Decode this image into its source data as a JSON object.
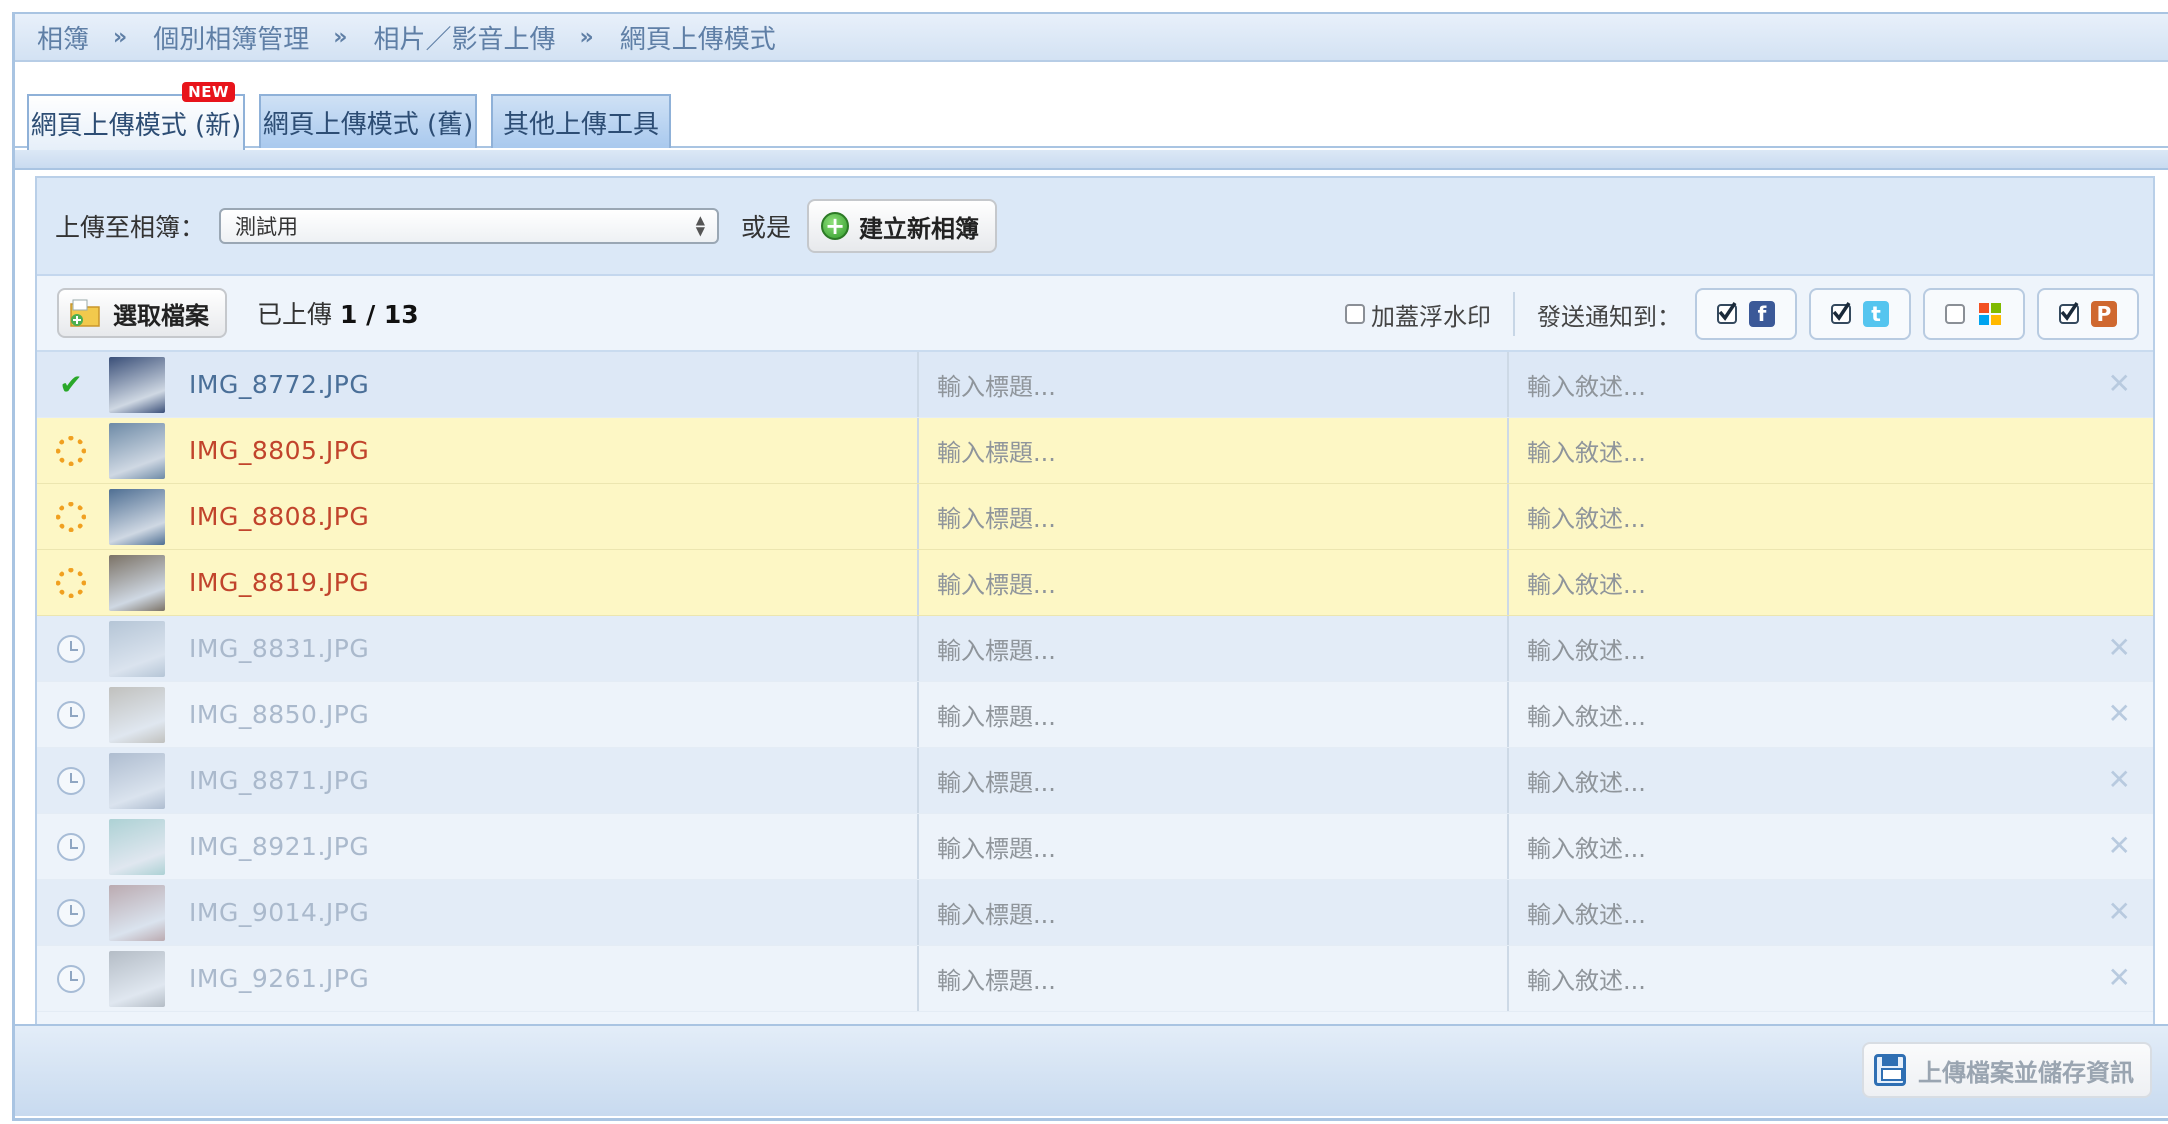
{
  "breadcrumb": {
    "items": [
      "相簿",
      "個別相簿管理",
      "相片／影音上傳",
      "網頁上傳模式"
    ],
    "separator": "»"
  },
  "tabs": [
    {
      "label": "網頁上傳模式 (新)",
      "badge": "NEW",
      "active": true
    },
    {
      "label": "網頁上傳模式 (舊)",
      "active": false
    },
    {
      "label": "其他上傳工具",
      "active": false
    }
  ],
  "album_row": {
    "label": "上傳至相簿：",
    "selected_album": "測試用",
    "or_text": "或是",
    "create_button": "建立新相簿"
  },
  "toolbar": {
    "pick_button": "選取檔案",
    "uploaded_label": "已上傳",
    "uploaded_count": "1 / 13",
    "watermark_label": "加蓋浮水印",
    "watermark_checked": false,
    "notify_label": "發送通知到：",
    "notify_targets": [
      {
        "icon": "facebook-icon",
        "checked": true,
        "color": "#3b5998"
      },
      {
        "icon": "twitter-icon",
        "checked": true,
        "color": "#55c5ef"
      },
      {
        "icon": "windows-live-icon",
        "checked": false,
        "color": "#f25022"
      },
      {
        "icon": "plurk-icon",
        "checked": true,
        "color": "#cf682f"
      }
    ]
  },
  "files": [
    {
      "name": "IMG_8772.JPG",
      "status": "done",
      "title_placeholder": "輸入標題...",
      "desc_placeholder": "輸入敘述...",
      "thumb": "#3a4f78"
    },
    {
      "name": "IMG_8805.JPG",
      "status": "uploading",
      "title_placeholder": "輸入標題...",
      "desc_placeholder": "輸入敘述...",
      "thumb": "#6d8aa6"
    },
    {
      "name": "IMG_8808.JPG",
      "status": "uploading",
      "title_placeholder": "輸入標題...",
      "desc_placeholder": "輸入敘述...",
      "thumb": "#4f6f93"
    },
    {
      "name": "IMG_8819.JPG",
      "status": "uploading",
      "title_placeholder": "輸入標題...",
      "desc_placeholder": "輸入敘述...",
      "thumb": "#7b7266"
    },
    {
      "name": "IMG_8831.JPG",
      "status": "pending",
      "title_placeholder": "輸入標題...",
      "desc_placeholder": "輸入敘述...",
      "thumb": "#7d96ae"
    },
    {
      "name": "IMG_8850.JPG",
      "status": "pending",
      "title_placeholder": "輸入標題...",
      "desc_placeholder": "輸入敘述...",
      "thumb": "#8a8374"
    },
    {
      "name": "IMG_8871.JPG",
      "status": "pending",
      "title_placeholder": "輸入標題...",
      "desc_placeholder": "輸入敘述...",
      "thumb": "#6e83a0"
    },
    {
      "name": "IMG_8921.JPG",
      "status": "pending",
      "title_placeholder": "輸入標題...",
      "desc_placeholder": "輸入敘述...",
      "thumb": "#5ea8a6"
    },
    {
      "name": "IMG_9014.JPG",
      "status": "pending",
      "title_placeholder": "輸入標題...",
      "desc_placeholder": "輸入敘述...",
      "thumb": "#8a5a5a"
    },
    {
      "name": "IMG_9261.JPG",
      "status": "pending",
      "title_placeholder": "輸入標題...",
      "desc_placeholder": "輸入敘述...",
      "thumb": "#6f7a86"
    }
  ],
  "footer": {
    "save_button": "上傳檔案並儲存資訊"
  }
}
